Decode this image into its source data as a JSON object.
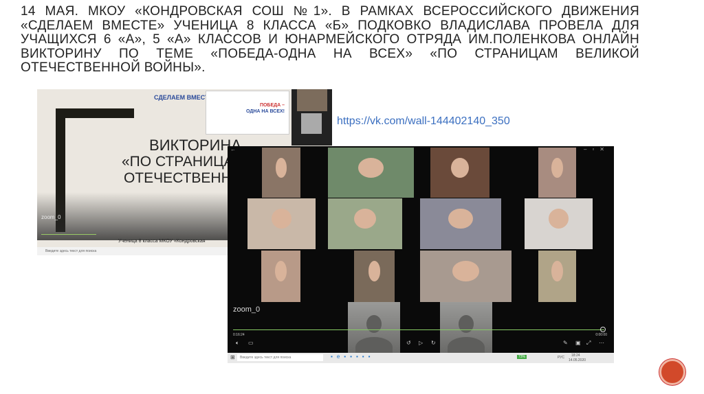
{
  "title": "14 мая. МКОУ «Кондровская СОШ №1». В рамках Всероссийского движения «Сделаем вместе» ученица 8 класса «Б» Подковко Владислава провела для учащихся 6 «А», 5 «А»  классов и юнармейского отряда им.Поленкова онлайн викторину по теме «Победа-одна на всех» «По страницам Великой Отечественной войны».",
  "link": "https://vk.com/wall-144402140_350",
  "back_screen": {
    "logo": "СДЕЛАЕМ ВМЕСТЕ!",
    "shared_title": "ПОБЕДА –",
    "shared_sub": "ОДНА НА ВСЕХ!",
    "quiz_line1": "ВИКТОРИНА",
    "quiz_line2": "«ПО СТРАНИЦАМ ВЕ",
    "quiz_line3": "ОТЕЧЕСТВЕННОЙ В",
    "recording": "zoom_0",
    "caption": "Ученица 8 класса МКОУ «Кондровская",
    "search": "Введите здесь текст для поиска"
  },
  "front_screen": {
    "recording": "zoom_0",
    "elapsed": "0:16:24",
    "remaining": "0:00:00",
    "search": "Введите здесь текст для поиска",
    "battery": "73%",
    "lang": "РУС",
    "clock": "18:24",
    "date": "14.05.2020"
  },
  "colors": {
    "accent": "#d2492a",
    "link": "#3b6fc0",
    "progress": "#8c6"
  }
}
